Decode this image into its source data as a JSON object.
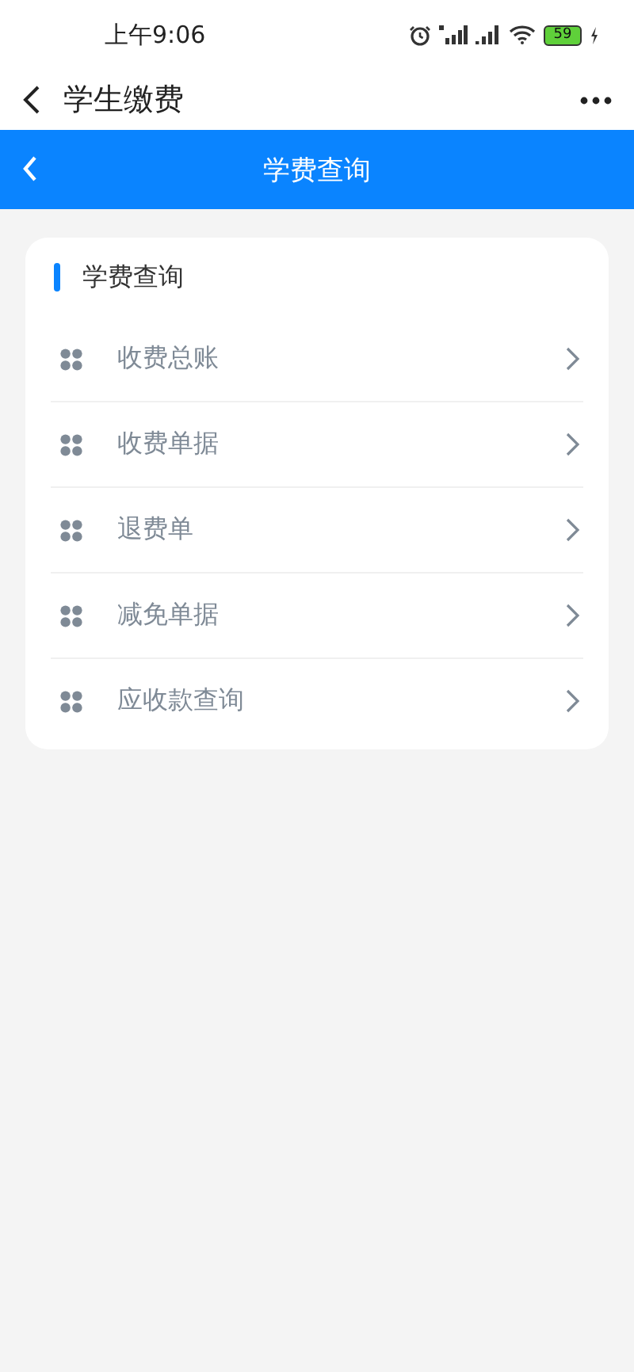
{
  "status_bar": {
    "time": "上午9:06",
    "battery": "59"
  },
  "app_bar": {
    "title": "学生缴费"
  },
  "header": {
    "title": "学费查询"
  },
  "card": {
    "title": "学费查询",
    "items": [
      {
        "label": "收费总账"
      },
      {
        "label": "收费单据"
      },
      {
        "label": "退费单"
      },
      {
        "label": "减免单据"
      },
      {
        "label": "应收款查询"
      }
    ]
  }
}
